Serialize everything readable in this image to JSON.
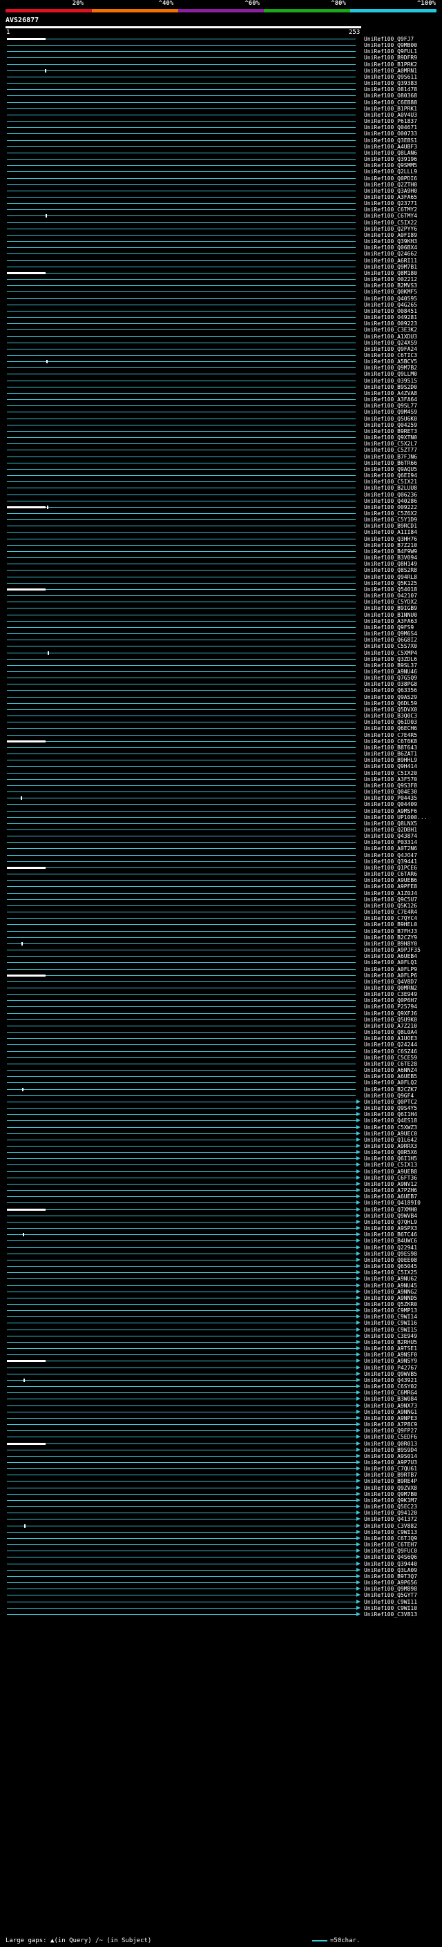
{
  "legend": {
    "percent_labels": [
      "20%",
      "^40%",
      "^60%",
      "^80%",
      "^100%"
    ],
    "colors": [
      "#e01020",
      "#f07000",
      "#8b1fa0",
      "#18a818",
      "#20c8e0"
    ]
  },
  "query": {
    "label": "AVS26877",
    "start": "1",
    "end": "253"
  },
  "colors": {
    "hit_line": "#3ec8d8",
    "query_bar": "#ffffff",
    "background": "#000000"
  },
  "hits": [
    "UniRef100_Q9FJ7",
    "UniRef100_Q9MB00",
    "UniRef100_Q9FUL1",
    "UniRef100_B9DFR9",
    "UniRef100_B1PRK2",
    "UniRef100_A0MRN1",
    "UniRef100_Q9S611",
    "UniRef100_Q39383",
    "UniRef100_O81478",
    "UniRef100_O80368",
    "UniRef100_C6EB88",
    "UniRef100_B1PRK1",
    "UniRef100_A0V4U3",
    "UniRef100_P61837",
    "UniRef100_Q04671",
    "UniRef100_O00733",
    "UniRef100_Q3EBS1",
    "UniRef100_A4UBF3",
    "UniRef100_Q8LAN6",
    "UniRef100_Q39196",
    "UniRef100_Q9SMM5",
    "UniRef100_Q2LLL9",
    "UniRef100_Q0PDI6",
    "UniRef100_Q2ZTH0",
    "UniRef100_Q3A9H0",
    "UniRef100_A3FA65",
    "UniRef100_Q23771",
    "UniRef100_C6TMY2",
    "UniRef100_C6TMY4",
    "UniRef100_C5IX22",
    "UniRef100_Q2PYY6",
    "UniRef100_A0FI89",
    "UniRef100_Q39KH3",
    "UniRef100_Q06BX4",
    "UniRef100_Q24662",
    "UniRef100_A6RI11",
    "UniRef100_Q9M7B1",
    "UniRef100_Q8M180",
    "UniRef100_O02212",
    "UniRef100_B2MVS3",
    "UniRef100_Q0KMF5",
    "UniRef100_Q40595",
    "UniRef100_Q4G265",
    "UniRef100_O08451",
    "UniRef100_O49281",
    "UniRef100_O09223",
    "UniRef100_C3E3K2",
    "UniRef100_A1XDU3",
    "UniRef100_Q24XS9",
    "UniRef100_Q9FA24",
    "UniRef100_C6TIC3",
    "UniRef100_A5BCV5",
    "UniRef100_Q9M7B2",
    "UniRef100_Q9LLM0",
    "UniRef100_O39515",
    "UniRef100_B9S2D0",
    "UniRef100_A4ZVA8",
    "UniRef100_A3FA64",
    "UniRef100_Q9SL77",
    "UniRef100_Q9M4S9",
    "UniRef100_Q5U6K0",
    "UniRef100_Q04259",
    "UniRef100_B9RET3",
    "UniRef100_Q9XTN0",
    "UniRef100_C5X2L7",
    "UniRef100_C5ZT77",
    "UniRef100_B7FJN6",
    "UniRef100_B6TR66",
    "UniRef100_Q9AQU5",
    "UniRef100_Q6EI94",
    "UniRef100_C5IX21",
    "UniRef100_B2LUU8",
    "UniRef100_Q06236",
    "UniRef100_Q40286",
    "UniRef100_O09222",
    "UniRef100_C5Z6X2",
    "UniRef100_C5Y1D9",
    "UniRef100_B9RCD1",
    "UniRef100_A1II84",
    "UniRef100_Q3HH76",
    "UniRef100_B7Z210",
    "UniRef100_B4F9W9",
    "UniRef100_B3V094",
    "UniRef100_Q8H149",
    "UniRef100_Q8S2R8",
    "UniRef100_Q94RL8",
    "UniRef100_Q5K125",
    "UniRef100_Q54018",
    "UniRef100_O42107",
    "UniRef100_C5YDX2",
    "UniRef100_B9IGB9",
    "UniRef100_B1NNU0",
    "UniRef100_A3FA63",
    "UniRef100_Q9FS9",
    "UniRef100_Q9M6S4",
    "UniRef100_Q6G8I2",
    "UniRef100_C5S7X0",
    "UniRef100_C5XMP4",
    "UniRef100_Q3ZDL6",
    "UniRef100_B9SL37",
    "UniRef100_A9NU46",
    "UniRef100_Q7G5Q9",
    "UniRef100_O38PG8",
    "UniRef100_Q63356",
    "UniRef100_Q9AS29",
    "UniRef100_Q6DL59",
    "UniRef100_Q5DVX0",
    "UniRef100_B3Q0C3",
    "UniRef100_Q6ID03",
    "UniRef100_Q6ECH6",
    "UniRef100_C7E4R5",
    "UniRef100_C6T6K8",
    "UniRef100_B8T643",
    "UniRef100_B6ZAT1",
    "UniRef100_B9HHL9",
    "UniRef100_Q9H414",
    "UniRef100_C5IX20",
    "UniRef100_A3F570",
    "UniRef100_Q9S3F8",
    "UniRef100_Q04E30",
    "UniRef100_P04435",
    "UniRef100_Q04409",
    "UniRef100_A9MSF6",
    "UniRef100_UP1000...",
    "UniRef100_Q8LNX5",
    "UniRef100_Q2DBH1",
    "UniRef100_Q43874",
    "UniRef100_P03314",
    "UniRef100_A0T2N6",
    "UniRef100_Q4JO47",
    "UniRef100_Q39441",
    "UniRef100_Q1PCE6",
    "UniRef100_C6TAR6",
    "UniRef100_A9UEB6",
    "UniRef100_A9PFE8",
    "UniRef100_A1Z0J4",
    "UniRef100_Q9C5U7",
    "UniRef100_Q5K126",
    "UniRef100_C7E4R4",
    "UniRef100_C7QYC4",
    "UniRef100_B9HEL0",
    "UniRef100_B7FHJ3",
    "UniRef100_B2CZY9",
    "UniRef100_B9H8Y0",
    "UniRef100_A9PJF35",
    "UniRef100_A6UEB4",
    "UniRef100_A0FLQ1",
    "UniRef100_A0FLP9",
    "UniRef100_A0FLP6",
    "UniRef100_Q4V8D7",
    "UniRef100_Q0MRN2",
    "UniRef100_C3E949",
    "UniRef100_Q0P6H7",
    "UniRef100_P25794",
    "UniRef100_Q9XFJ6",
    "UniRef100_Q5U9K0",
    "UniRef100_A7Z210",
    "UniRef100_Q8L0A4",
    "UniRef100_A1UOE3",
    "UniRef100_Q24244",
    "UniRef100_C6SZ46",
    "UniRef100_C5CE59",
    "UniRef100_C6TE28",
    "UniRef100_A6NNZ4",
    "UniRef100_A6UEB5",
    "UniRef100_A0FLQ2",
    "UniRef100_B2CZK7",
    "UniRef100_Q9GF4",
    "UniRef100_Q0PTC2",
    "UniRef100_Q9S4Y5",
    "UniRef100_Q6I1H4",
    "UniRef100_Q4ES18",
    "UniRef100_C5XWZ3",
    "UniRef100_A9UEC0",
    "UniRef100_Q1L642",
    "UniRef100_A9RRX3",
    "UniRef100_Q0R5X6",
    "UniRef100_Q6I1H5",
    "UniRef100_C5IX13",
    "UniRef100_A9UEB8",
    "UniRef100_C6FT36",
    "UniRef100_A9NV12",
    "UniRef100_A7PZH6",
    "UniRef100_A6UEB7",
    "UniRef100_Q4189I0",
    "UniRef100_Q7XMH0",
    "UniRef100_Q9WVB4",
    "UniRef100_Q7QHL9",
    "UniRef100_A9SPX3",
    "UniRef100_B6TC46",
    "UniRef100_B4UWC6",
    "UniRef100_Q22941",
    "UniRef100_Q9ES98",
    "UniRef100_Q0EE08",
    "UniRef100_Q65045",
    "UniRef100_C5IX25",
    "UniRef100_A9NU62",
    "UniRef100_A9NU45",
    "UniRef100_A9NNG2",
    "UniRef100_A9NND5",
    "UniRef100_Q5ZKR0",
    "UniRef100_C9MP13",
    "UniRef100_C9WI14",
    "UniRef100_C9WI16",
    "UniRef100_C9WI15",
    "UniRef100_C3E949",
    "UniRef100_B2RHU5",
    "UniRef100_A9TSE1",
    "UniRef100_A9NSF0",
    "UniRef100_A9NSY9",
    "UniRef100_P42767",
    "UniRef100_Q9WVB5",
    "UniRef100_Q43921",
    "UniRef100_C6SY02",
    "UniRef100_C6MRG4",
    "UniRef100_B3W084",
    "UniRef100_A9NX73",
    "UniRef100_A9NNG1",
    "UniRef100_A9NPE3",
    "UniRef100_A7P8C9",
    "UniRef100_Q9FP27",
    "UniRef100_C5EDF6",
    "UniRef100_Q0R013",
    "UniRef100_B9S9D4",
    "UniRef100_A9S014",
    "UniRef100_A9P7U3",
    "UniRef100_C7QU61",
    "UniRef100_B9RTB7",
    "UniRef100_B9RE4P",
    "UniRef100_Q9ZVX8",
    "UniRef100_Q9M7B0",
    "UniRef100_Q9K1M7",
    "UniRef100_Q5EC23",
    "UniRef100_Q94120",
    "UniRef100_Q41372",
    "UniRef100_C3V882",
    "UniRef100_C9WI13",
    "UniRef100_C6TJQ9",
    "UniRef100_C6TEH7",
    "UniRef100_Q9FUC0",
    "UniRef100_Q4S6Q6",
    "UniRef100_Q39440",
    "UniRef100_Q3LA09",
    "UniRef100_B9T3Q7",
    "UniRef100_A9P656",
    "UniRef100_Q9M898",
    "UniRef100_Q5GYT7",
    "UniRef100_C9WI11",
    "UniRef100_C9WI10",
    "UniRef100_C3V813"
  ],
  "footer": {
    "left_label": "Large gaps:",
    "query_gap": "▲(in Query)",
    "subject_gap": "/~ (in Subject)",
    "key_label": "=50char."
  }
}
